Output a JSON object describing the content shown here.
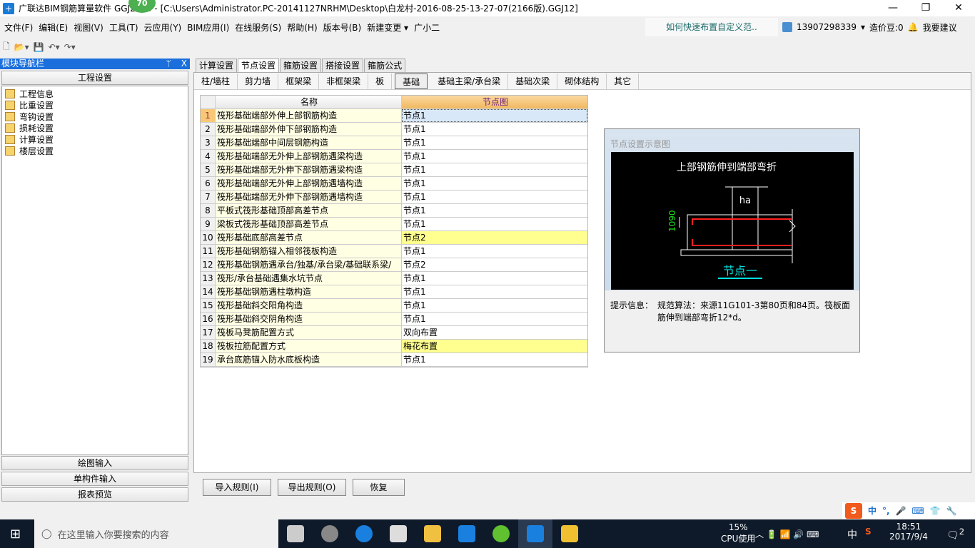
{
  "window": {
    "title": "广联达BIM钢筋算量软件 GGJ2013 - [C:\\Users\\Administrator.PC-20141127NRHM\\Desktop\\白龙村-2016-08-25-13-27-07(2166版).GGJ12]",
    "badge": "70",
    "minimize": "—",
    "maximize": "❐",
    "close": "✕"
  },
  "menu": [
    "文件(F)",
    "编辑(E)",
    "视图(V)",
    "工具(T)",
    "云应用(Y)",
    "BIM应用(I)",
    "在线服务(S)",
    "帮助(H)",
    "版本号(B)",
    "新建变更 ▾",
    "广小二"
  ],
  "help_link": "如何快速布置自定义范..",
  "user": {
    "phone": "13907298339",
    "caret": "▾",
    "beans": "造价豆:0",
    "suggest": "我要建议"
  },
  "toolbar": [
    "🗋",
    "📂▾",
    "💾",
    "↶▾",
    "↷▾"
  ],
  "nav": {
    "title": "模块导航栏",
    "pin": "ᛘ",
    "close": "X",
    "section": "工程设置",
    "items": [
      "工程信息",
      "比重设置",
      "弯钩设置",
      "损耗设置",
      "计算设置",
      "楼层设置"
    ],
    "bottom": [
      "绘图输入",
      "单构件输入",
      "报表预览"
    ]
  },
  "tabs": [
    "计算设置",
    "节点设置",
    "箍筋设置",
    "搭接设置",
    "箍筋公式"
  ],
  "active_tab": 1,
  "subtabs": [
    "柱/墙柱",
    "剪力墙",
    "框架梁",
    "非框架梁",
    "板",
    "基础",
    "基础主梁/承台梁",
    "基础次梁",
    "砌体结构",
    "其它"
  ],
  "active_subtab": 5,
  "grid": {
    "headers": [
      "名称",
      "节点图"
    ],
    "rows": [
      [
        "1",
        "筏形基础端部外伸上部钢筋构造",
        "节点1"
      ],
      [
        "2",
        "筏形基础端部外伸下部钢筋构造",
        "节点1"
      ],
      [
        "3",
        "筏形基础端部中间层钢筋构造",
        "节点1"
      ],
      [
        "4",
        "筏形基础端部无外伸上部钢筋遇梁构造",
        "节点1"
      ],
      [
        "5",
        "筏形基础端部无外伸下部钢筋遇梁构造",
        "节点1"
      ],
      [
        "6",
        "筏形基础端部无外伸上部钢筋遇墙构造",
        "节点1"
      ],
      [
        "7",
        "筏形基础端部无外伸下部钢筋遇墙构造",
        "节点1"
      ],
      [
        "8",
        "平板式筏形基础顶部高差节点",
        "节点1"
      ],
      [
        "9",
        "梁板式筏形基础顶部高差节点",
        "节点1"
      ],
      [
        "10",
        "筏形基础底部高差节点",
        "节点2"
      ],
      [
        "11",
        "筏形基础钢筋锚入相邻筏板构造",
        "节点1"
      ],
      [
        "12",
        "筏形基础钢筋遇承台/独基/承台梁/基础联系梁/",
        "节点2"
      ],
      [
        "13",
        "筏形/承台基础遇集水坑节点",
        "节点1"
      ],
      [
        "14",
        "筏形基础钢筋遇柱墩构造",
        "节点1"
      ],
      [
        "15",
        "筏形基础斜交阳角构造",
        "节点1"
      ],
      [
        "16",
        "筏形基础斜交阴角构造",
        "节点1"
      ],
      [
        "17",
        "筏板马凳筋配置方式",
        "双向布置"
      ],
      [
        "18",
        "筏板拉筋配置方式",
        "梅花布置"
      ],
      [
        "19",
        "承台底筋锚入防水底板构造",
        "节点1"
      ]
    ],
    "selected_row": 0,
    "highlight_rows": [
      9,
      17
    ]
  },
  "diagram": {
    "title": "节点设置示意图",
    "heading": "上部钢筋伸到端部弯折",
    "dim_ha": "ha",
    "dim_value": "1090",
    "node_label": "节点一",
    "info_label": "提示信息：",
    "info_text": "规范算法：来源11G101-3第80页和84页。筏板面筋伸到端部弯折12*d。"
  },
  "buttons": {
    "import": "导入规则(I)",
    "export": "导出规则(O)",
    "restore": "恢复"
  },
  "ime": {
    "lang": "中",
    "punct": "°,"
  },
  "taskbar": {
    "search_placeholder": "在这里输入你要搜索的内容",
    "cpu": "15%",
    "cpu_label": "CPU使用",
    "ime": "中",
    "time": "18:51",
    "date": "2017/9/4",
    "notifications": "2"
  },
  "colors": {
    "nav_header": "#1a6fdc",
    "grid_header": "#f0b860",
    "name_col": "#ffffe4",
    "highlight": "#ffff90",
    "rebar": "#ff2020",
    "dim_text": "#20e020",
    "node_label": "#00e0e0"
  }
}
